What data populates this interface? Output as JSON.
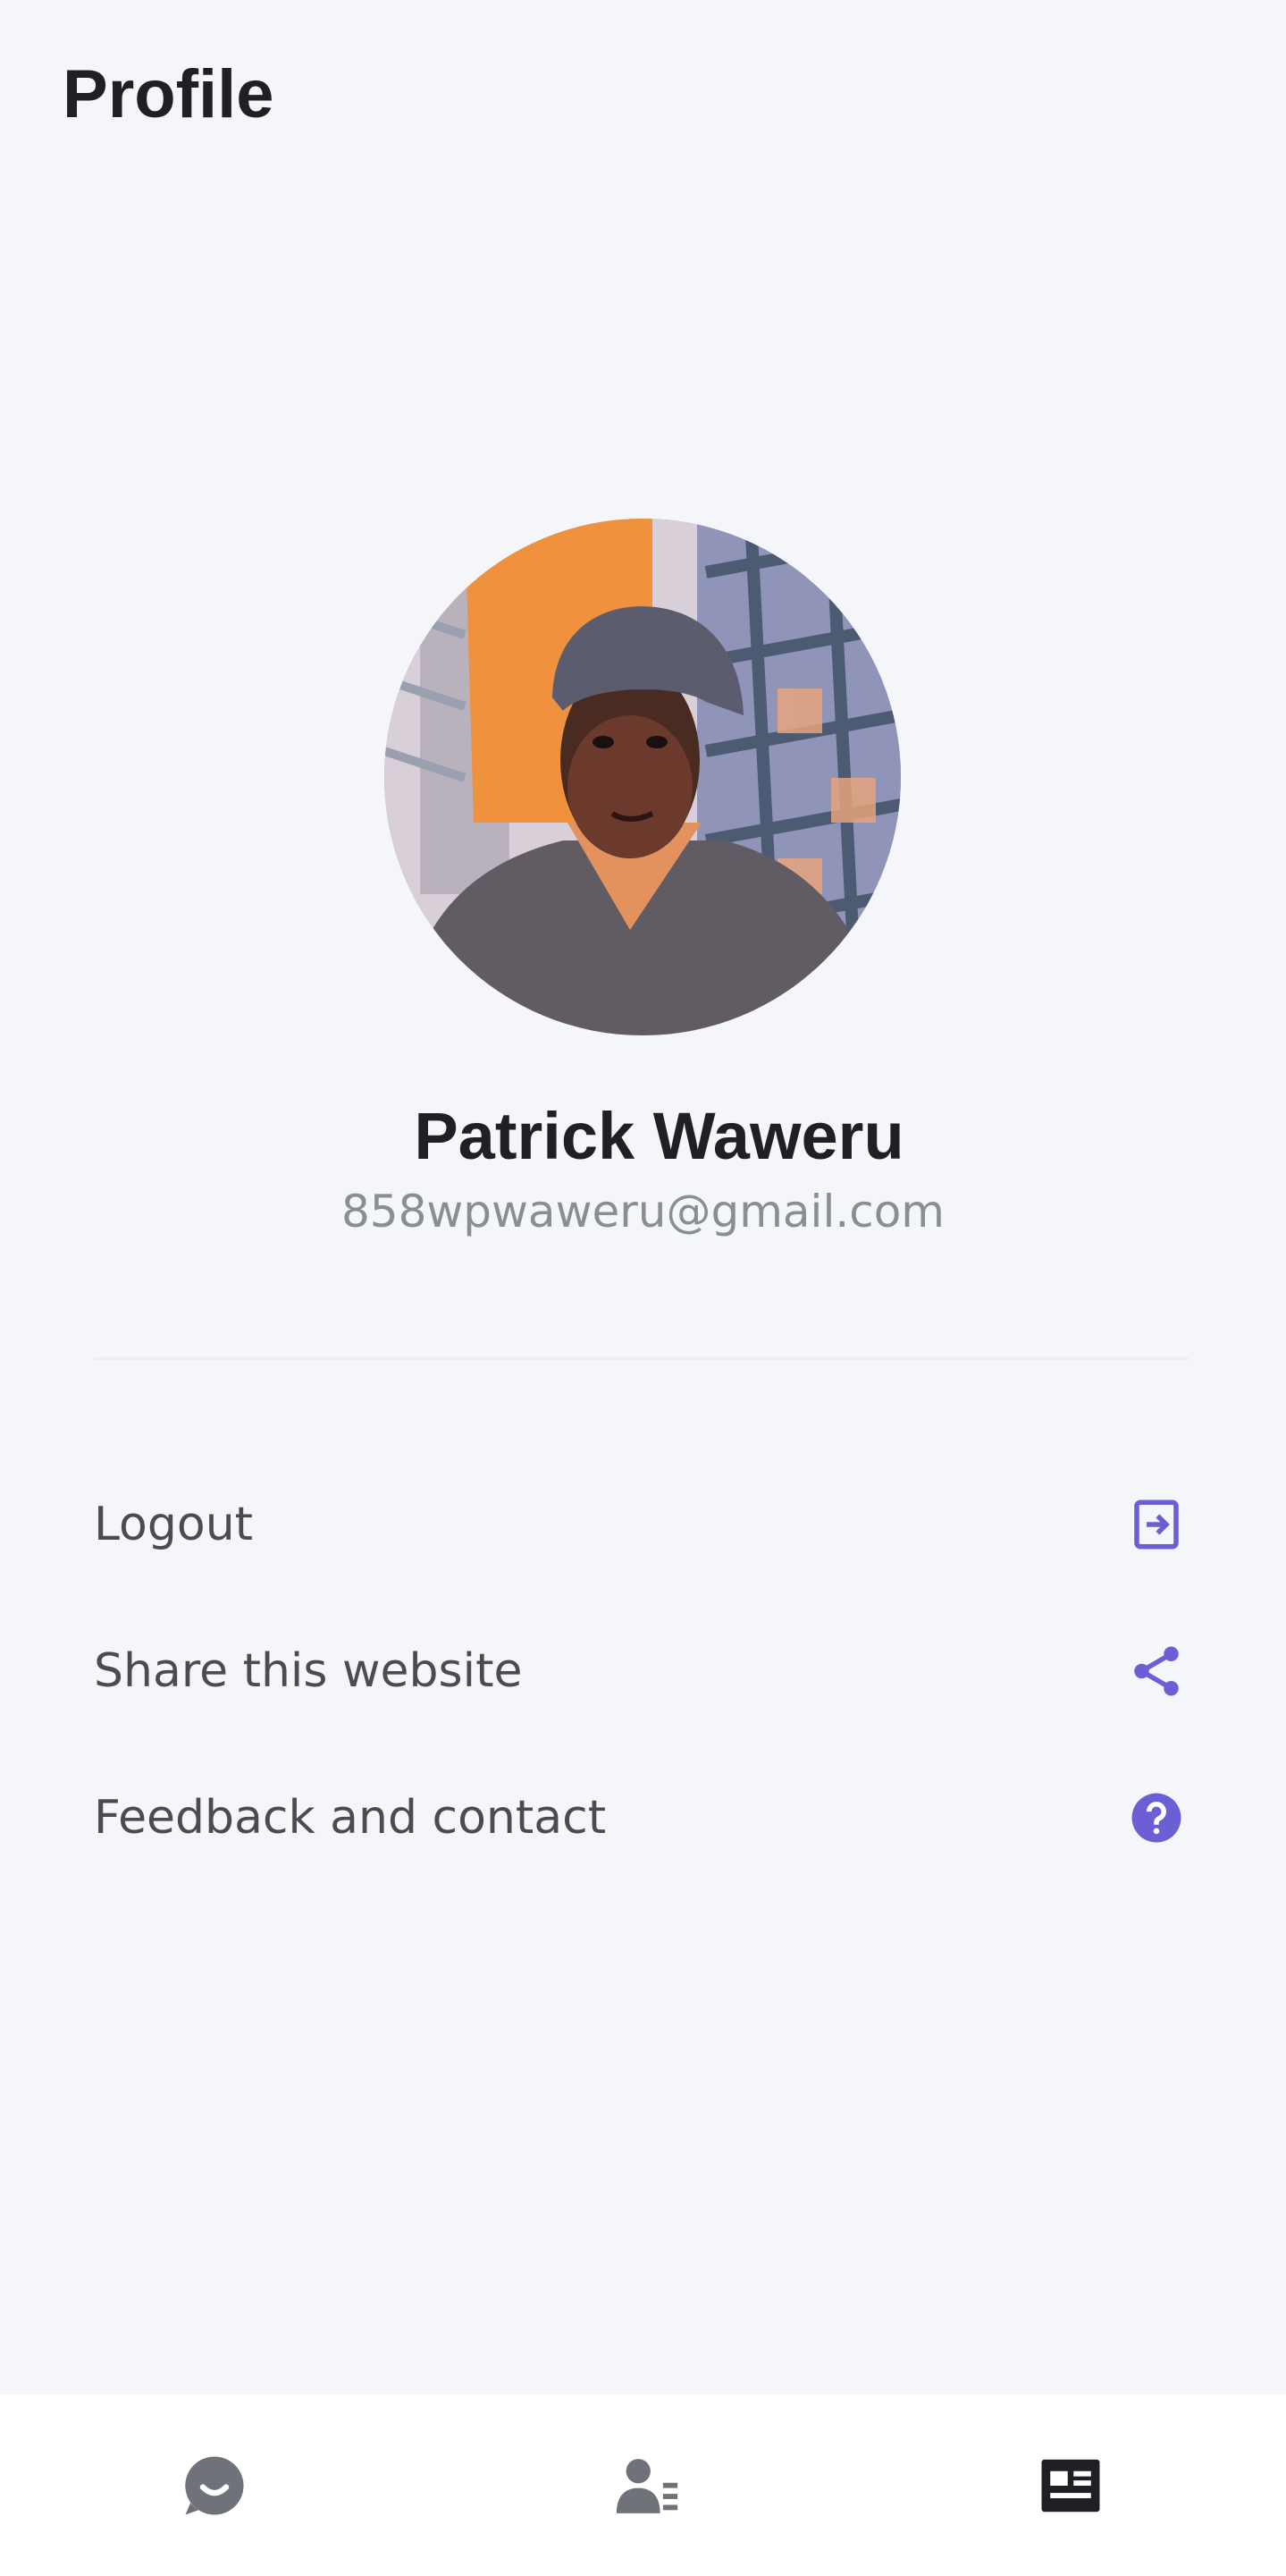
{
  "header": {
    "title": "Profile"
  },
  "profile": {
    "avatar_icon": "user-photo",
    "name": "Patrick Waweru",
    "email": "858wpwaweru@gmail.com"
  },
  "menu": {
    "items": [
      {
        "label": "Logout",
        "icon": "logout-icon"
      },
      {
        "label": "Share this website",
        "icon": "share-icon"
      },
      {
        "label": "Feedback and contact",
        "icon": "help-icon"
      }
    ]
  },
  "bottom_nav": {
    "tabs": [
      {
        "icon": "chat-icon"
      },
      {
        "icon": "contacts-icon"
      },
      {
        "icon": "news-icon"
      }
    ]
  },
  "colors": {
    "accent": "#6b5fd6",
    "background": "#f5f6fa",
    "text_primary": "#1f2024",
    "text_secondary": "#8a8d94",
    "nav_icon": "#6f7278",
    "nav_icon_active": "#1f2024"
  }
}
